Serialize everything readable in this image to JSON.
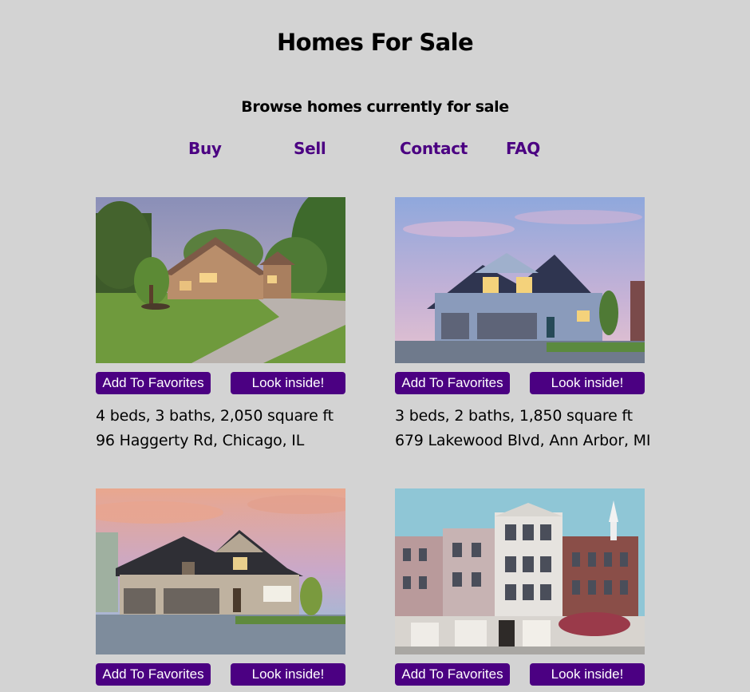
{
  "header": {
    "title": "Homes For Sale",
    "subtitle": "Browse homes currently for sale"
  },
  "nav": [
    {
      "label": "Buy"
    },
    {
      "label": "Sell"
    },
    {
      "label": "Contact"
    },
    {
      "label": "FAQ"
    }
  ],
  "listings": [
    {
      "image": "brick-house-photo",
      "favorite_label": "Add To Favorites",
      "look_label": "Look inside!",
      "details": "4 beds, 3 baths, 2,050 square ft",
      "address": "96 Haggerty Rd, Chicago, IL"
    },
    {
      "image": "blue-house-photo",
      "favorite_label": "Add To Favorites",
      "look_label": "Look inside!",
      "details": "3 beds, 2 baths, 1,850 square ft",
      "address": "679 Lakewood Blvd, Ann Arbor, MI"
    },
    {
      "image": "craftsman-house-photo",
      "favorite_label": "Add To Favorites",
      "look_label": "Look inside!"
    },
    {
      "image": "townhouse-row-photo",
      "favorite_label": "Add To Favorites",
      "look_label": "Look inside!"
    }
  ],
  "colors": {
    "background": "#d3d3d3",
    "accent": "#4b0082",
    "button_text": "#ffffff"
  }
}
